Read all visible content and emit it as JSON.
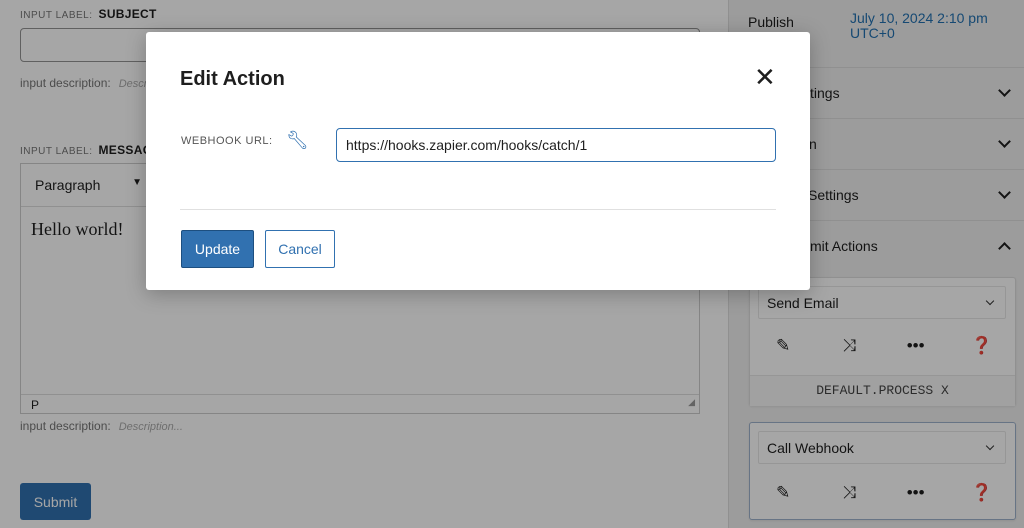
{
  "form": {
    "subject": {
      "label_prefix": "INPUT LABEL:",
      "label": "SUBJECT",
      "desc_label": "input description:",
      "desc_placeholder": "Description..."
    },
    "message": {
      "label_prefix": "INPUT LABEL:",
      "label": "MESSAGE",
      "block_type": "Paragraph",
      "content": "Hello world!",
      "status_path": "P",
      "desc_label": "input description:",
      "desc_placeholder": "Description..."
    },
    "submit_label": "Submit"
  },
  "sidebar": {
    "publish_label": "Publish",
    "publish_date": "July 10, 2024 2:10 pm",
    "publish_tz": "UTC+0",
    "panels": [
      {
        "label": "tings"
      },
      {
        "label": "n"
      },
      {
        "label": "Settings"
      },
      {
        "label": "mit Actions"
      }
    ],
    "actions": [
      {
        "name": "Send Email",
        "footer": "DEFAULT.PROCESS X"
      },
      {
        "name": "Call Webhook"
      }
    ]
  },
  "modal": {
    "title": "Edit Action",
    "field_label": "WEBHOOK URL:",
    "field_value": "https://hooks.zapier.com/hooks/catch/1",
    "update_label": "Update",
    "cancel_label": "Cancel"
  },
  "colors": {
    "accent": "#3171b0",
    "link": "#2271b1"
  }
}
